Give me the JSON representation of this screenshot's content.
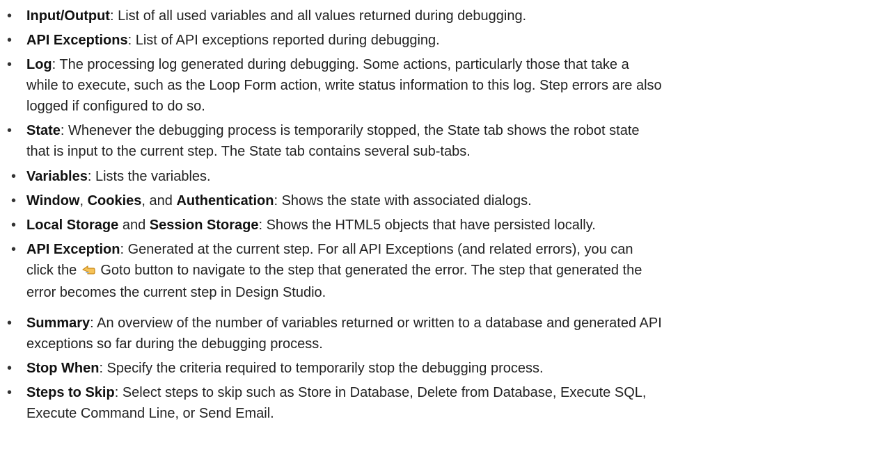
{
  "items": [
    {
      "term": "Input/Output",
      "text": ": List of all used variables and all values returned during debugging."
    },
    {
      "term": "API Exceptions",
      "text": ": List of API exceptions reported during debugging."
    },
    {
      "term": "Log",
      "line1": ": The processing log generated during debugging. Some actions, particularly those that take a",
      "line2": "while to execute, such as the Loop Form action, write status information to this log. Step errors are also",
      "line3": "logged if configured to do so."
    },
    {
      "term": "State",
      "line1": ": Whenever the debugging process is temporarily stopped, the State tab shows the robot state",
      "line2": "that is input to the current step. The State tab contains several sub-tabs."
    },
    {
      "term": "Summary",
      "line1": ": An overview of the number of variables returned or written to a database and generated API",
      "line2": "exceptions so far during the debugging process."
    },
    {
      "term": "Stop When",
      "text": ": Specify the criteria required to temporarily stop the debugging process."
    },
    {
      "term": "Steps to Skip",
      "line1": ": Select steps to skip such as Store in Database, Delete from Database, Execute SQL,",
      "line2": "Execute Command Line, or Send Email."
    }
  ],
  "state_sub": {
    "variables": {
      "term": "Variables",
      "text": ": Lists the variables."
    },
    "window": {
      "term1": "Window",
      "sep1": ", ",
      "term2": "Cookies",
      "sep2": ", and ",
      "term3": "Authentication",
      "text": ": Shows the state with associated dialogs."
    },
    "storage": {
      "term1": "Local Storage",
      "sep1": " and ",
      "term2": "Session Storage",
      "text": ": Shows the HTML5 objects that have persisted locally."
    },
    "api": {
      "term": "API Exception",
      "line1": ": Generated at the current step. For all API Exceptions (and related errors), you can",
      "line2_pre": "click the ",
      "line2_post": " Goto button to navigate to the step that generated the error. The step that generated the",
      "line3": "error becomes the current step in Design Studio."
    }
  },
  "bullet": "•",
  "icon_names": {
    "goto": "goto-arrow-icon"
  },
  "colors": {
    "text": "#222222",
    "goto_icon_fill": "#f6c257",
    "goto_icon_stroke": "#c98a1a"
  }
}
